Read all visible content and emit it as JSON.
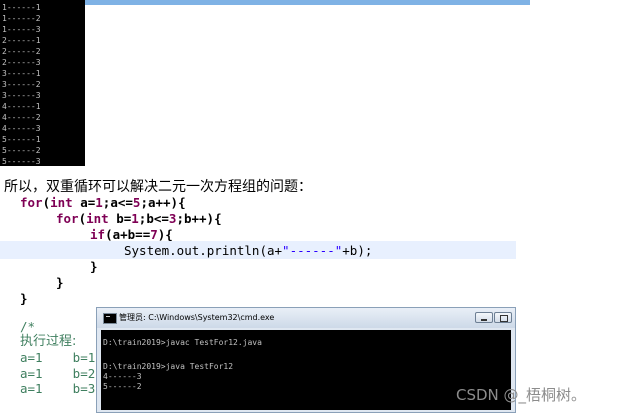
{
  "top_console": {
    "lines": [
      "1------1",
      "1------2",
      "1------3",
      "2------1",
      "2------2",
      "2------3",
      "3------1",
      "3------2",
      "3------3",
      "4------1",
      "4------2",
      "4------3",
      "5------1",
      "5------2",
      "5------3"
    ]
  },
  "paragraph": "所以，双重循环可以解决二元一次方程组的问题：",
  "code": {
    "line1": {
      "kw": "for",
      "p1": "(",
      "kw2": "int",
      "p2": " a=",
      "n1": "1",
      "p3": ";a<=",
      "n2": "5",
      "p4": ";a++){"
    },
    "line2": {
      "kw": "for",
      "p1": "(",
      "kw2": "int",
      "p2": " b=",
      "n1": "1",
      "p3": ";b<=",
      "n2": "3",
      "p4": ";b++){"
    },
    "line3": {
      "kw": "if",
      "p1": "(a+b==",
      "n1": "7",
      "p2": "){"
    },
    "line4": {
      "p1": "System.out.println(a+",
      "str": "\"------\"",
      "p2": "+b);"
    },
    "line5": "}",
    "line6": "}",
    "line7": "}",
    "comment_open": "/*",
    "comment_title": "执行过程:",
    "comment_rows": [
      "a=1    b=1",
      "a=1    b=2",
      "a=1    b=3"
    ]
  },
  "cmd": {
    "title": "管理员: C:\\Windows\\System32\\cmd.exe",
    "lines": [
      "D:\\train2019>javac TestFor12.java",
      "",
      "D:\\train2019>java TestFor12",
      "4------3",
      "5------2"
    ]
  },
  "watermark": "CSDN @_梧桐树。"
}
